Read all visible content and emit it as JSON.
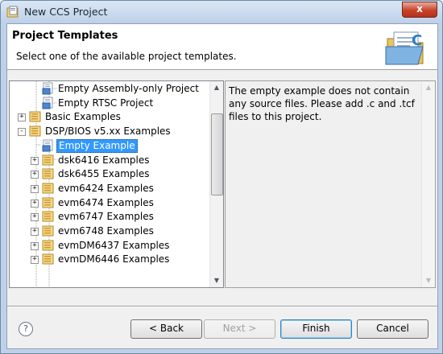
{
  "window": {
    "title": "New CCS Project",
    "close_label": "x"
  },
  "header": {
    "title": "Project Templates",
    "description": "Select one of the available project templates."
  },
  "tree": {
    "items": [
      {
        "label": "Empty Assembly-only Project",
        "depth": 2,
        "expander": "",
        "icon": "project-template-icon",
        "selected": false
      },
      {
        "label": "Empty RTSC Project",
        "depth": 2,
        "expander": "",
        "icon": "project-template-icon",
        "selected": false
      },
      {
        "label": "Basic Examples",
        "depth": 1,
        "expander": "+",
        "icon": "folder-examples-icon",
        "selected": false
      },
      {
        "label": "DSP/BIOS v5.xx Examples",
        "depth": 1,
        "expander": "-",
        "icon": "folder-examples-icon",
        "selected": false
      },
      {
        "label": "Empty Example",
        "depth": 2,
        "expander": "",
        "icon": "project-template-icon",
        "selected": true
      },
      {
        "label": "dsk6416 Examples",
        "depth": 2,
        "expander": "+",
        "icon": "folder-examples-icon",
        "selected": false
      },
      {
        "label": "dsk6455 Examples",
        "depth": 2,
        "expander": "+",
        "icon": "folder-examples-icon",
        "selected": false
      },
      {
        "label": "evm6424 Examples",
        "depth": 2,
        "expander": "+",
        "icon": "folder-examples-icon",
        "selected": false
      },
      {
        "label": "evm6474 Examples",
        "depth": 2,
        "expander": "+",
        "icon": "folder-examples-icon",
        "selected": false
      },
      {
        "label": "evm6747 Examples",
        "depth": 2,
        "expander": "+",
        "icon": "folder-examples-icon",
        "selected": false
      },
      {
        "label": "evm6748 Examples",
        "depth": 2,
        "expander": "+",
        "icon": "folder-examples-icon",
        "selected": false
      },
      {
        "label": "evmDM6437 Examples",
        "depth": 2,
        "expander": "+",
        "icon": "folder-examples-icon",
        "selected": false
      },
      {
        "label": "evmDM6446 Examples",
        "depth": 2,
        "expander": "+",
        "icon": "folder-examples-icon",
        "selected": false
      }
    ]
  },
  "description_text": "The empty example does not contain any source files. Please add .c and .tcf files to this project.",
  "buttons": {
    "help": "?",
    "back": "< Back",
    "next": "Next >",
    "finish": "Finish",
    "cancel": "Cancel"
  },
  "colors": {
    "selection": "#3399ff",
    "title_bar": "#bfd1e8"
  }
}
